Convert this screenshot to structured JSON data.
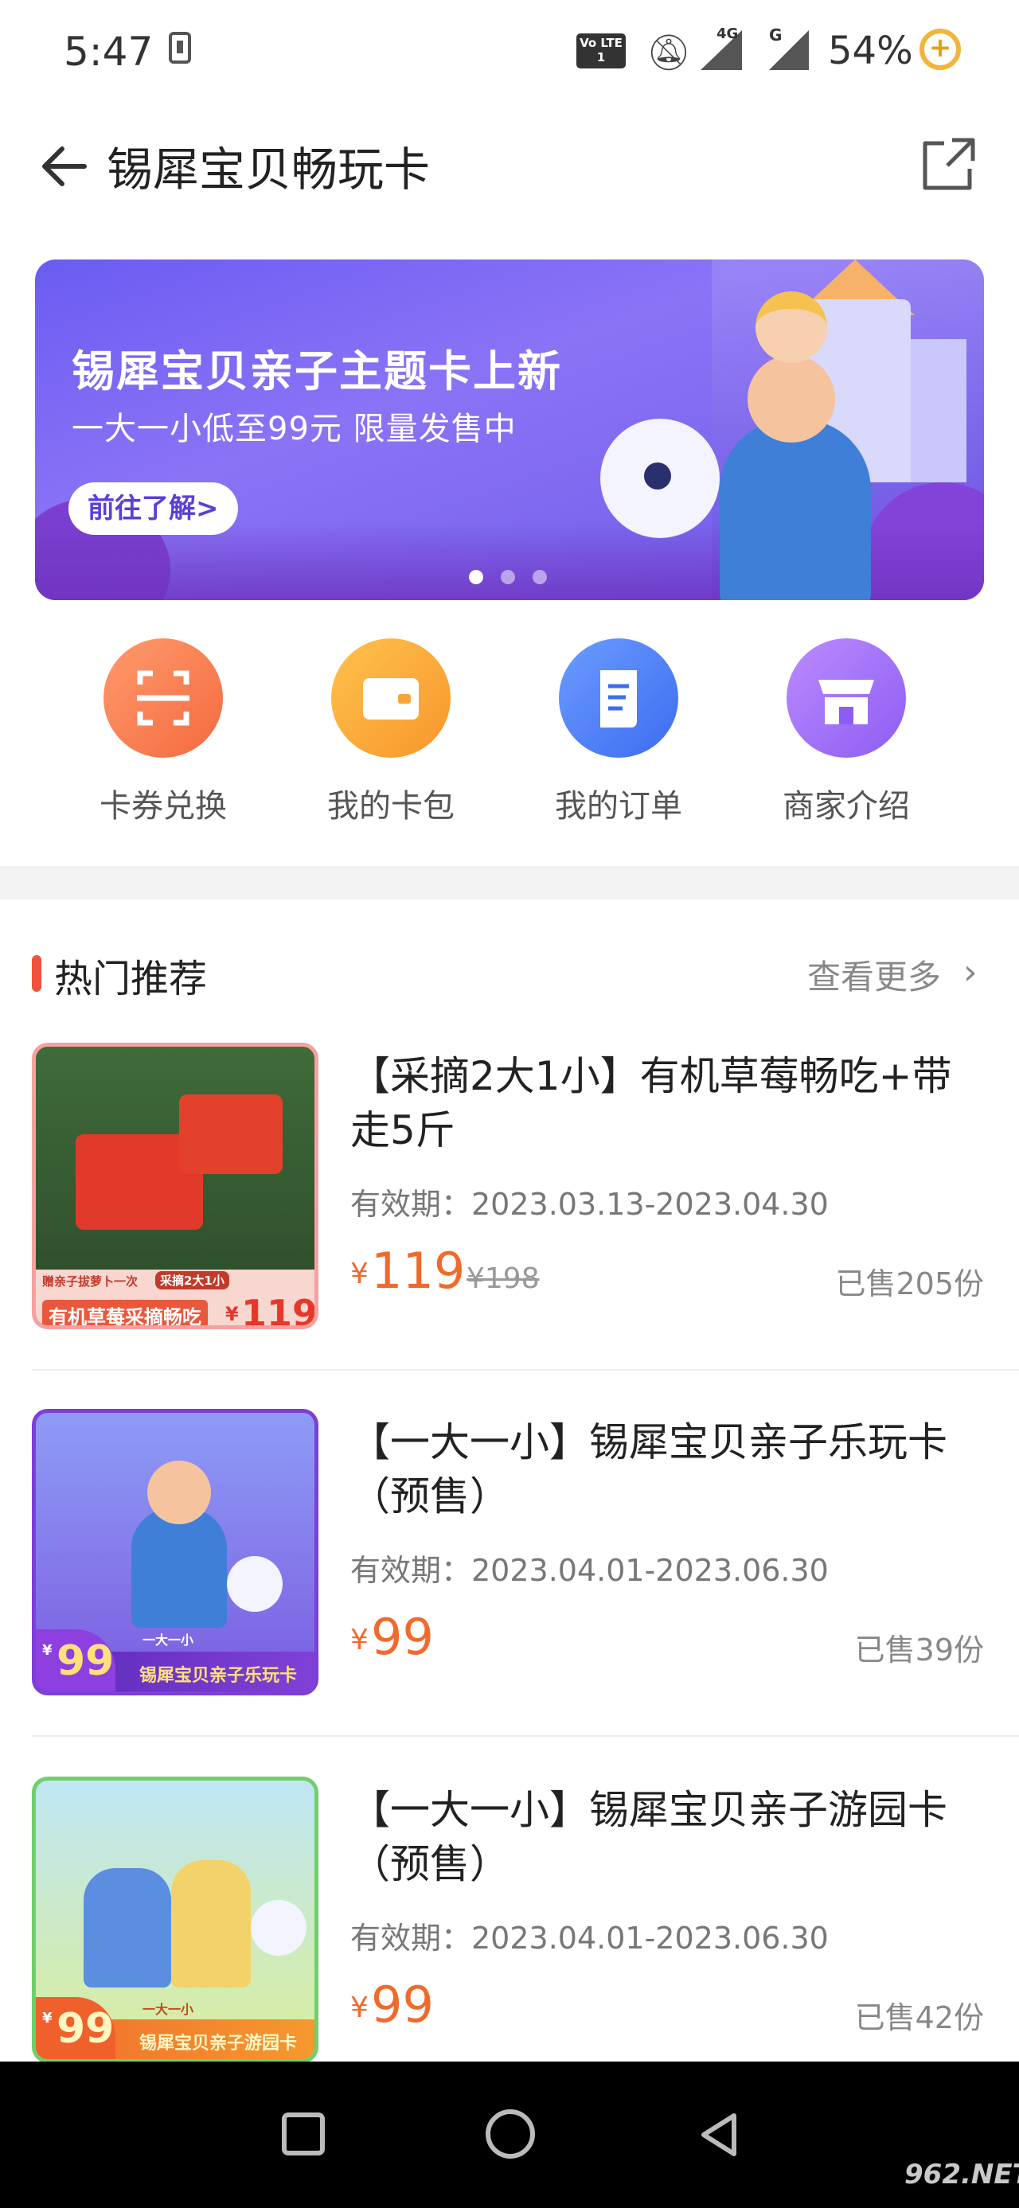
{
  "status_bar": {
    "time": "5:47",
    "volte": "Vo LTE 1",
    "signal1_label": "4G",
    "signal2_label": "G",
    "battery": "54%"
  },
  "header": {
    "title": "锡犀宝贝畅玩卡"
  },
  "banner": {
    "headline": "锡犀宝贝亲子主题卡上新",
    "subline": "一大一小低至99元  限量发售中",
    "cta": "前往了解>",
    "active_dot": 0,
    "dot_count": 3
  },
  "actions": [
    {
      "label": "卡券兑换",
      "icon": "scan-icon",
      "color_from": "#ff9a6c",
      "color_to": "#f46a3f"
    },
    {
      "label": "我的卡包",
      "icon": "wallet-icon",
      "color_from": "#ffc24e",
      "color_to": "#f7962b"
    },
    {
      "label": "我的订单",
      "icon": "order-icon",
      "color_from": "#6b9cff",
      "color_to": "#3d6cf0"
    },
    {
      "label": "商家介绍",
      "icon": "store-icon",
      "color_from": "#bb8cff",
      "color_to": "#8d5cf2"
    }
  ],
  "section": {
    "title": "热门推荐",
    "more": "查看更多"
  },
  "products": [
    {
      "name": "【采摘2大1小】有机草莓畅吃+带走5斤",
      "validity": "有效期：2023.03.13-2023.04.30",
      "currency": "¥",
      "price": "119",
      "original_price": "¥198",
      "sold": "已售205份",
      "thumb": {
        "tag1": "赠亲子拔萝卜一次",
        "tag2": "采摘2大1小",
        "caption": "有机草莓采摘畅吃",
        "badge": "119",
        "badge_currency": "¥"
      }
    },
    {
      "name": "【一大一小】锡犀宝贝亲子乐玩卡（预售）",
      "validity": "有效期：2023.04.01-2023.06.30",
      "currency": "¥",
      "price": "99",
      "original_price": "",
      "sold": "已售39份",
      "thumb": {
        "tag1": "一大一小",
        "caption": "锡犀宝贝亲子乐玩卡",
        "badge": "99",
        "badge_currency": "¥"
      }
    },
    {
      "name": "【一大一小】锡犀宝贝亲子游园卡（预售）",
      "validity": "有效期：2023.04.01-2023.06.30",
      "currency": "¥",
      "price": "99",
      "original_price": "",
      "sold": "已售42份",
      "thumb": {
        "tag1": "一大一小",
        "caption": "锡犀宝贝亲子游园卡",
        "badge": "99",
        "badge_currency": "¥"
      }
    }
  ],
  "watermark": "962.NET"
}
